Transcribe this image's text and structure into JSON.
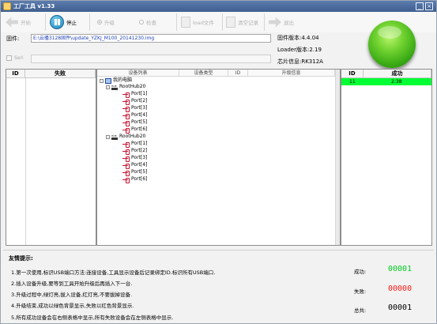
{
  "app": {
    "title": "工厂工具 v1.33"
  },
  "toolbar": {
    "start_label": "开始",
    "stop_label": "停止",
    "mode_upgrade_label": "升级",
    "mode_check_label": "检查",
    "load_file_label": "load文件",
    "clear_record_label": "清空记录",
    "exit_label": "退出"
  },
  "firmware": {
    "label": "固件:",
    "path": "E:\\云播3128固件\\update_YZKJ_M100_20141230.img"
  },
  "serial": {
    "checkbox_label": "Seri",
    "value": ""
  },
  "info": {
    "firmware_version": "固件版本:4.4.04",
    "loader_version": "Loader版本:2.19",
    "chip_info": "芯片信息:RK312A"
  },
  "fail_table": {
    "col_id": "ID",
    "col_fail": "失败"
  },
  "success_table": {
    "col_id": "ID",
    "col_success": "成功",
    "rows": [
      {
        "id": "11",
        "value": "2:38"
      }
    ]
  },
  "device_tree": {
    "cols": {
      "device_list": "设备列表",
      "device_type": "设备类型",
      "id": "ID",
      "upgrade_info": "升级信息"
    },
    "root": "我的电脑",
    "hubs": [
      {
        "name": "RootHub20",
        "ports": [
          "Port[1]",
          "Port[2]",
          "Port[3]",
          "Port[4]",
          "Port[5]",
          "Port[6]"
        ]
      },
      {
        "name": "RootHub20",
        "ports": [
          "Port[1]",
          "Port[2]",
          "Port[3]",
          "Port[4]",
          "Port[5]",
          "Port[6]"
        ]
      }
    ]
  },
  "tips": {
    "title": "友情提示:",
    "lines": [
      "1.第一次使用,标识USB端口方法:连接设备,工具显示设备后记录绑定ID.标识所有USB端口.",
      "2.插入设备升级,要等到工具开始升级后再插入下一台.",
      "3.升级过程中,绿灯亮,拔入设备,红灯亮,不要拔掉设备.",
      "4.升级结束,成功以绿色背景显示,失败以红色背景显示.",
      "5.所有成功设备会在右侧表格中显示,所有失败设备会在左侧表格中显示."
    ]
  },
  "stats": {
    "success_label": "成功:",
    "success_value": "00001",
    "success_color": "#00cc22",
    "fail_label": "失败:",
    "fail_value": "00000",
    "fail_color": "#ff1a1a",
    "total_label": "总共:",
    "total_value": "00001",
    "total_color": "#000000"
  }
}
